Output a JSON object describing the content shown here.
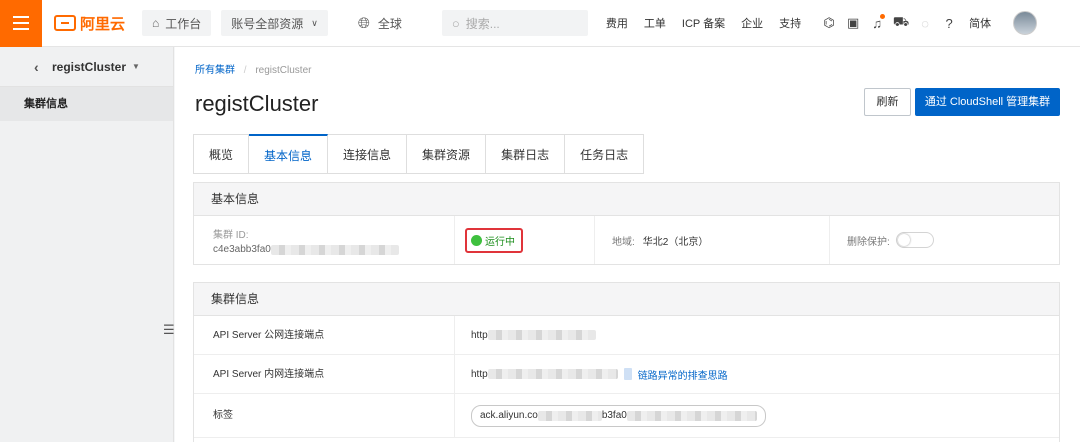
{
  "topbar": {
    "logo_text": "阿里云",
    "workbench": "工作台",
    "account_scope": "账号全部资源",
    "region": "全球",
    "search_placeholder": "搜索...",
    "links": [
      "费用",
      "工单",
      "ICP 备案",
      "企业",
      "支持"
    ],
    "lang": "简体",
    "icons": [
      "cloud-shell-icon",
      "terminal-icon",
      "bell-icon",
      "cart-icon",
      "bulb-icon",
      "help-icon"
    ]
  },
  "sidebar": {
    "cluster_name": "registCluster",
    "items": [
      {
        "label": "集群信息"
      }
    ]
  },
  "breadcrumb": {
    "root": "所有集群",
    "current": "registCluster"
  },
  "page": {
    "title": "registCluster"
  },
  "buttons": {
    "refresh": "刷新",
    "cloudshell": "通过 CloudShell 管理集群"
  },
  "tabs": [
    {
      "label": "概览",
      "active": false
    },
    {
      "label": "基本信息",
      "active": true
    },
    {
      "label": "连接信息",
      "active": false
    },
    {
      "label": "集群资源",
      "active": false
    },
    {
      "label": "集群日志",
      "active": false
    },
    {
      "label": "任务日志",
      "active": false
    }
  ],
  "basic_info": {
    "heading": "基本信息",
    "cluster_id_label": "集群 ID:",
    "cluster_id_value": "c4e3abb3fa0",
    "status": "运行中",
    "status_color": "#3ec03e",
    "region_label": "地域:",
    "region_value": "华北2（北京）",
    "delete_protect_label": "删除保护:",
    "delete_protect_on": false
  },
  "cluster_info": {
    "heading": "集群信息",
    "rows": [
      {
        "key": "API Server 公网连接端点",
        "value": "http",
        "link": ""
      },
      {
        "key": "API Server 内网连接端点",
        "value": "http",
        "link": "链路异常的排查思路"
      },
      {
        "key": "标签",
        "value": "ack.aliyun.co",
        "tag_suffix": "b3fa0"
      }
    ]
  },
  "colors": {
    "accent": "#ff6a00",
    "primary": "#0064c8",
    "alert": "#e0343a"
  }
}
